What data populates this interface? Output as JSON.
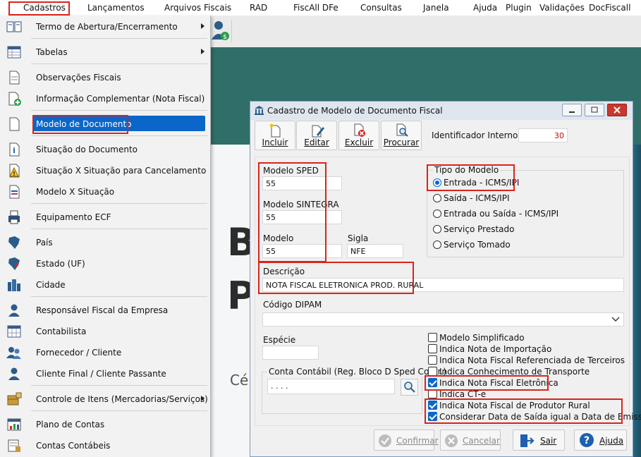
{
  "menubar": {
    "items": [
      "Cadastros",
      "Lançamentos",
      "Arquivos Fiscais",
      "RAD",
      "FiscAll DFe",
      "Consultas",
      "Janela",
      "Ajuda",
      "Plugin",
      "Validações",
      "DocFiscall"
    ]
  },
  "background": {
    "letter1": "B",
    "letter2": "P",
    "text_fragment": "Cé"
  },
  "menu": {
    "items": [
      {
        "label": "Termo de Abertura/Encerramento",
        "icon": "book-icon"
      },
      {
        "label": "Tabelas",
        "icon": "table-icon"
      },
      {
        "label": "Observações Fiscais",
        "icon": "document-icon"
      },
      {
        "label": "Informação Complementar (Nota Fiscal)",
        "icon": "document-add-icon"
      },
      {
        "label": "Modelo de Documento",
        "icon": "blank-document-icon"
      },
      {
        "label": "Situação do Documento",
        "icon": "document-info-icon"
      },
      {
        "label": "Situação X Situação para Cancelamento",
        "icon": "document-warning-icon"
      },
      {
        "label": "Modelo X Situação",
        "icon": "document-list-icon"
      },
      {
        "label": "Equipamento ECF",
        "icon": "printer-icon"
      },
      {
        "label": "País",
        "icon": "map-icon"
      },
      {
        "label": "Estado (UF)",
        "icon": "state-map-icon"
      },
      {
        "label": "Cidade",
        "icon": "city-icon"
      },
      {
        "label": "Responsável Fiscal da Empresa",
        "icon": "person-icon"
      },
      {
        "label": "Contabilista",
        "icon": "spreadsheet-icon"
      },
      {
        "label": "Fornecedor / Cliente",
        "icon": "people-icon"
      },
      {
        "label": "Cliente Final / Cliente Passante",
        "icon": "person-icon"
      },
      {
        "label": "Controle de Itens (Mercadorias/Serviços)",
        "icon": "box-icon"
      },
      {
        "label": "Plano de Contas",
        "icon": "chart-document-icon"
      },
      {
        "label": "Contas Contábeis",
        "icon": "ledger-icon"
      }
    ]
  },
  "dialog": {
    "title": "Cadastro de Modelo de Documento Fiscal",
    "toolbar": {
      "incluir": "Incluir",
      "editar": "Editar",
      "excluir": "Excluir",
      "procurar": "Procurar"
    },
    "identificador_label": "Identificador Interno:",
    "identificador_value": "30",
    "modelo_sped_label": "Modelo SPED",
    "modelo_sped_value": "55",
    "modelo_sintegra_label": "Modelo SINTEGRA",
    "modelo_sintegra_value": "55",
    "modelo_label": "Modelo",
    "modelo_value": "55",
    "sigla_label": "Sigla",
    "sigla_value": "NFE",
    "tipo_label": "Tipo do Modelo",
    "tipo_options": [
      "Entrada - ICMS/IPI",
      "Saída - ICMS/IPI",
      "Entrada ou Saída - ICMS/IPI",
      "Serviço Prestado",
      "Serviço Tomado"
    ],
    "tipo_selected": "Entrada - ICMS/IPI",
    "descricao_label": "Descrição",
    "descricao_value": "NOTA FISCAL ELETRONICA PROD. RURAL",
    "dipam_label": "Código DIPAM",
    "dipam_value": "",
    "especie_label": "Espécie",
    "especie_value": "",
    "conta_label": "Conta Contábil (Reg. Bloco D Sped Contr.)",
    "conta_value": ". . . .",
    "checkboxes": [
      {
        "label": "Modelo Simplificado",
        "checked": false
      },
      {
        "label": "Indica Nota de Importação",
        "checked": false
      },
      {
        "label": "Indica Nota Fiscal Referenciada de Terceiros",
        "checked": false
      },
      {
        "label": "Indica Conhecimento de Transporte",
        "checked": false
      },
      {
        "label": "Indica Nota Fiscal Eletrônica",
        "checked": true
      },
      {
        "label": "Indica CT-e",
        "checked": false
      },
      {
        "label": "Indica Nota Fiscal de Produtor Rural",
        "checked": true
      },
      {
        "label": "Considerar Data de Saída igual a Data de Emissão",
        "checked": true
      }
    ],
    "buttons": {
      "confirmar": "Confirmar",
      "cancelar": "Cancelar",
      "sair": "Sair",
      "ajuda": "Ajuda"
    }
  },
  "colors": {
    "highlight": "#0b66c9",
    "annotation": "#d9241c",
    "teal": "#2f6e69"
  }
}
